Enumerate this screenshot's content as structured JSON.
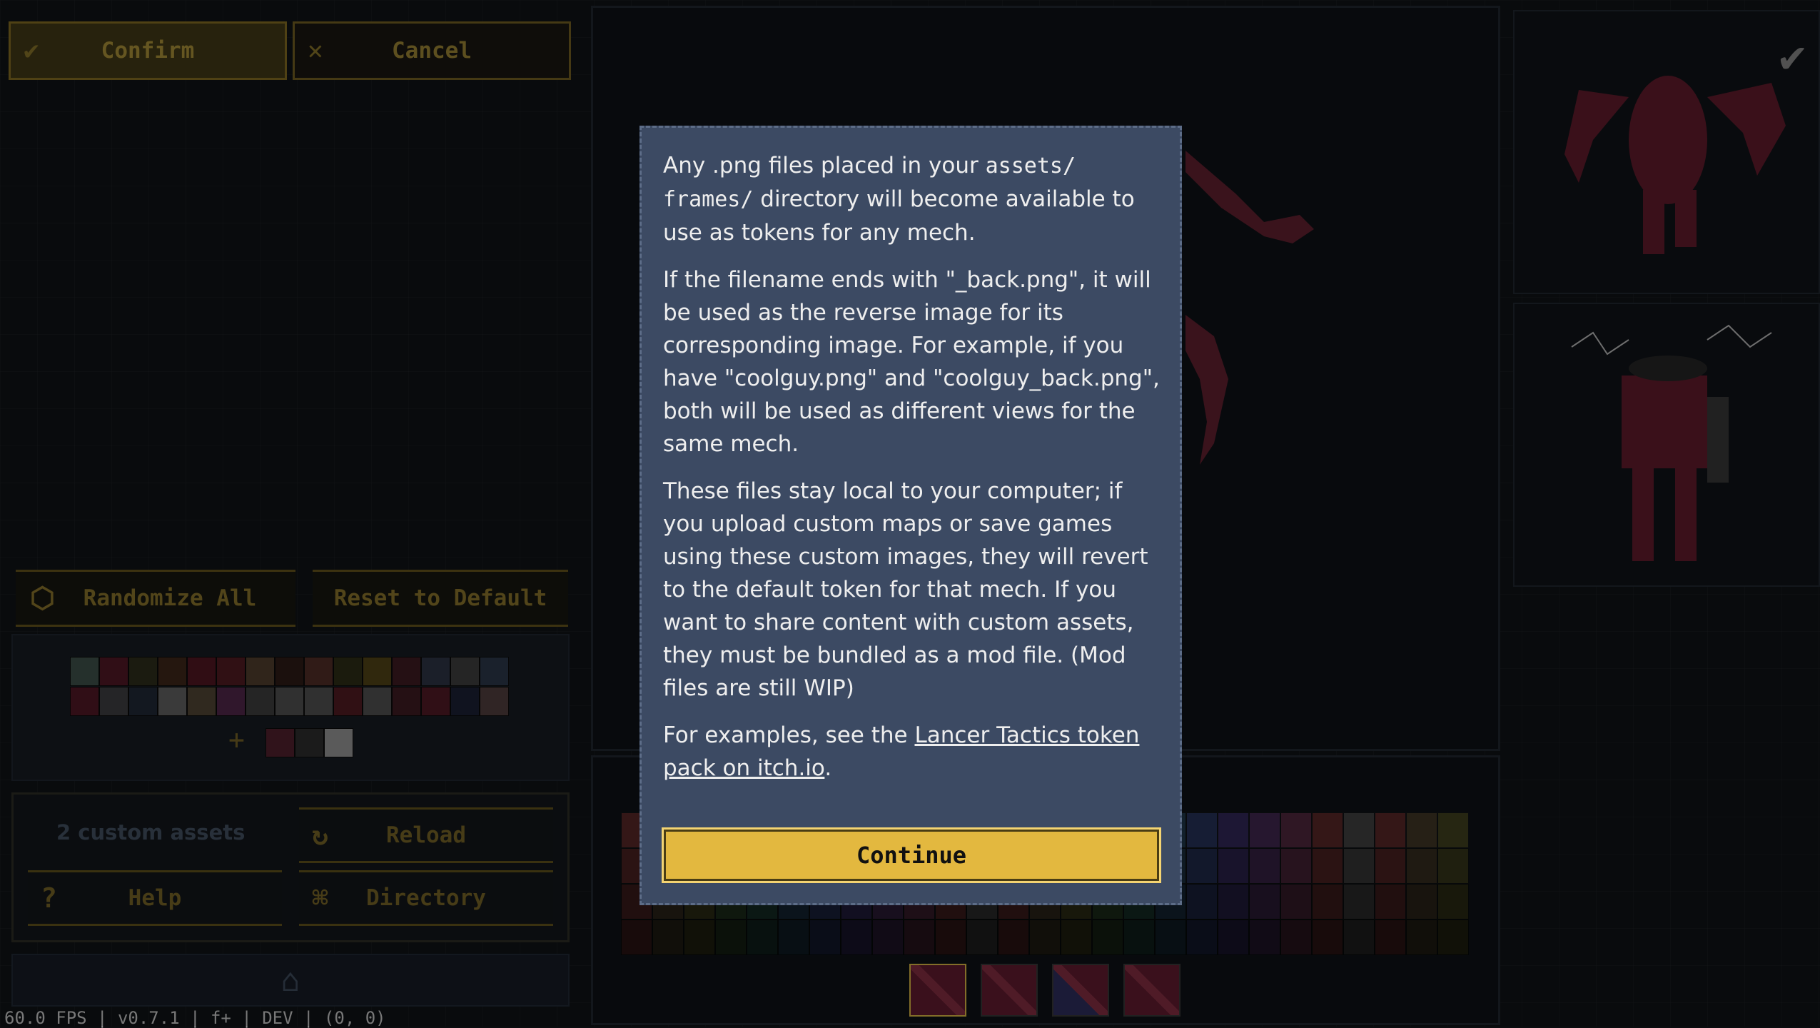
{
  "toolbar": {
    "confirm_label": "Confirm",
    "cancel_label": "Cancel"
  },
  "palette_actions": {
    "randomize_label": "Randomize All",
    "reset_label": "Reset to Default"
  },
  "palette": {
    "row1": [
      "#3a4a44",
      "#4a1622",
      "#2a2a1a",
      "#3a2418",
      "#4a1420",
      "#4a1a20",
      "#4a3a2a",
      "#2a1a14",
      "#4a2a24",
      "#2a2a14",
      "#4a3e14",
      "#3a1a20",
      "#2a3040",
      "#3a3a3a",
      "#283444"
    ],
    "row2": [
      "#4a1622",
      "#3a3a3c",
      "#1e2632",
      "#5a5a5a",
      "#4a4030",
      "#4a2444",
      "#3a3a3a",
      "#4a4a4a",
      "#4a4a4a",
      "#4a1a20",
      "#4a4a4a",
      "#3a1a20",
      "#4a1822",
      "#1a1e30",
      "#4a3a3a"
    ],
    "selected": [
      "#4a1e2a",
      "#2a2a2a",
      "#8a8a8a"
    ],
    "add_symbol": "+"
  },
  "assets": {
    "count_label": "2 custom assets",
    "reload_label": "Reload",
    "help_label": "Help",
    "directory_label": "Directory"
  },
  "icons": {
    "confirm": "check-icon",
    "cancel": "close-icon",
    "randomize": "d20-icon",
    "reload": "reload-icon",
    "help": "question-icon",
    "directory": "tree-icon",
    "paint": "brush-icon"
  },
  "status_bar": "60.0 FPS | v0.7.1 | f+ | DEV | (0, 0)",
  "modal": {
    "p1_a": "Any .png files placed in your ",
    "p1_code1": "assets/",
    "p1_code2": "frames/",
    "p1_b": " directory will become available to use as tokens for any mech.",
    "p2": "If the filename ends with \"_back.png\", it will be used as the reverse image for its corresponding image. For example, if you have \"coolguy.png\" and \"coolguy_back.png\", both will be used as different views for the same mech.",
    "p3": "These files stay local to your computer; if you upload custom maps or save games using these custom images, they will revert to the default token for that mech. If you want to share content with custom assets, they must be bundled as a mod file. (Mod files are still WIP)",
    "p4_a": "For examples, see the ",
    "p4_link": "Lancer Tactics token pack on itch.io",
    "p4_b": ".",
    "continue_label": "Continue"
  },
  "colors": {
    "accent": "#e3b83f",
    "modal_bg": "#3c4a63"
  }
}
